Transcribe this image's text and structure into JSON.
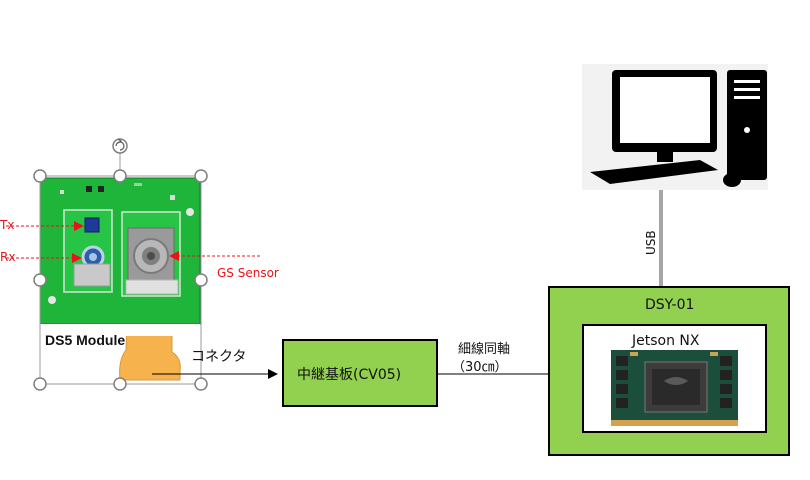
{
  "module": {
    "name": "DS5 Module",
    "tx_label": "Tx",
    "rx_label": "Rx",
    "sensor_label": "GS Sensor"
  },
  "connector_label": "コネクタ",
  "relay_board": {
    "label": "中継基板(CV05)",
    "fill": "#92d050"
  },
  "coax": {
    "label_line1": "細線同軸",
    "label_line2": "（30㎝）"
  },
  "usb_label": "USB",
  "dsy": {
    "label": "DSY-01",
    "inner_label": "Jetson NX",
    "fill": "#92d050"
  },
  "colors": {
    "pcb_green": "#1fb43a",
    "flex_orange": "#f5b24d",
    "annotation_red": "#e8141b",
    "usb_line": "#a6a6a6"
  }
}
